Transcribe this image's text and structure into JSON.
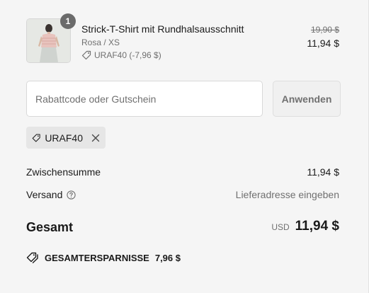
{
  "line_item": {
    "quantity": "1",
    "title": "Strick-T-Shirt mit Rundhalsausschnitt",
    "variant": "Rosa / XS",
    "discount": "URAF40 (-7,96 $)",
    "original_price": "19,90 $",
    "price": "11,94 $"
  },
  "discount_form": {
    "placeholder": "Rabattcode oder Gutschein",
    "value": "",
    "apply_label": "Anwenden"
  },
  "applied_code": {
    "code": "URAF40"
  },
  "totals": {
    "subtotal_label": "Zwischensumme",
    "subtotal_value": "11,94 $",
    "shipping_label": "Versand",
    "shipping_value": "Lieferadresse eingeben",
    "total_label": "Gesamt",
    "currency": "USD",
    "total_value": "11,94 $",
    "savings_label": "GESAMTERSPARNISSE",
    "savings_value": "7,96 $"
  },
  "colors": {
    "background": "#f5f5f5",
    "muted_text": "#707070",
    "badge": "#6b6b6b",
    "chip": "#e6e6e6"
  },
  "icons": {
    "product": "product-thumbnail",
    "discount_tag": "tag-icon",
    "remove": "close-icon",
    "help": "question-circle-icon",
    "savings": "double-tag-icon"
  }
}
